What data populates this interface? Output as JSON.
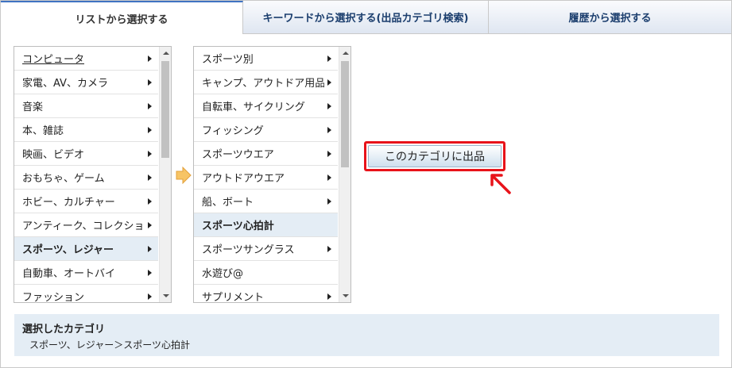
{
  "tabs": [
    {
      "label": "リストから選択する",
      "active": true
    },
    {
      "label": "キーワードから選択する(出品カテゴリ検索)",
      "active": false
    },
    {
      "label": "履歴から選択する",
      "active": false
    }
  ],
  "list1": {
    "items": [
      {
        "label": "コンピュータ",
        "has_children": true
      },
      {
        "label": "家電、AV、カメラ",
        "has_children": true
      },
      {
        "label": "音楽",
        "has_children": true
      },
      {
        "label": "本、雑誌",
        "has_children": true
      },
      {
        "label": "映画、ビデオ",
        "has_children": true
      },
      {
        "label": "おもちゃ、ゲーム",
        "has_children": true
      },
      {
        "label": "ホビー、カルチャー",
        "has_children": true
      },
      {
        "label": "アンティーク、コレクション",
        "has_children": true
      },
      {
        "label": "スポーツ、レジャー",
        "has_children": true,
        "selected": true
      },
      {
        "label": "自動車、オートバイ",
        "has_children": true
      },
      {
        "label": "ファッション",
        "has_children": true
      }
    ]
  },
  "list2": {
    "items": [
      {
        "label": "スポーツ別",
        "has_children": true
      },
      {
        "label": "キャンプ、アウトドア用品",
        "has_children": true
      },
      {
        "label": "自転車、サイクリング",
        "has_children": true
      },
      {
        "label": "フィッシング",
        "has_children": true
      },
      {
        "label": "スポーツウエア",
        "has_children": true
      },
      {
        "label": "アウトドアウエア",
        "has_children": true
      },
      {
        "label": "船、ボート",
        "has_children": true
      },
      {
        "label": "スポーツ心拍計",
        "has_children": false,
        "selected": true
      },
      {
        "label": "スポーツサングラス",
        "has_children": true
      },
      {
        "label": "水遊び@",
        "has_children": false
      },
      {
        "label": "サプリメント",
        "has_children": true
      }
    ]
  },
  "submit_button": {
    "label": "このカテゴリに出品"
  },
  "selected_category": {
    "title": "選択したカテゴリ",
    "path": "スポーツ、レジャー＞スポーツ心拍計"
  },
  "colors": {
    "highlight_red": "#e8131a",
    "selected_bg": "#e4edf5",
    "tab_text": "#1a3d6d",
    "arrow_orange": "#f5b544"
  },
  "icons": {
    "next_step": "right-arrow-icon",
    "pointer": "pointer-arrow-icon"
  }
}
